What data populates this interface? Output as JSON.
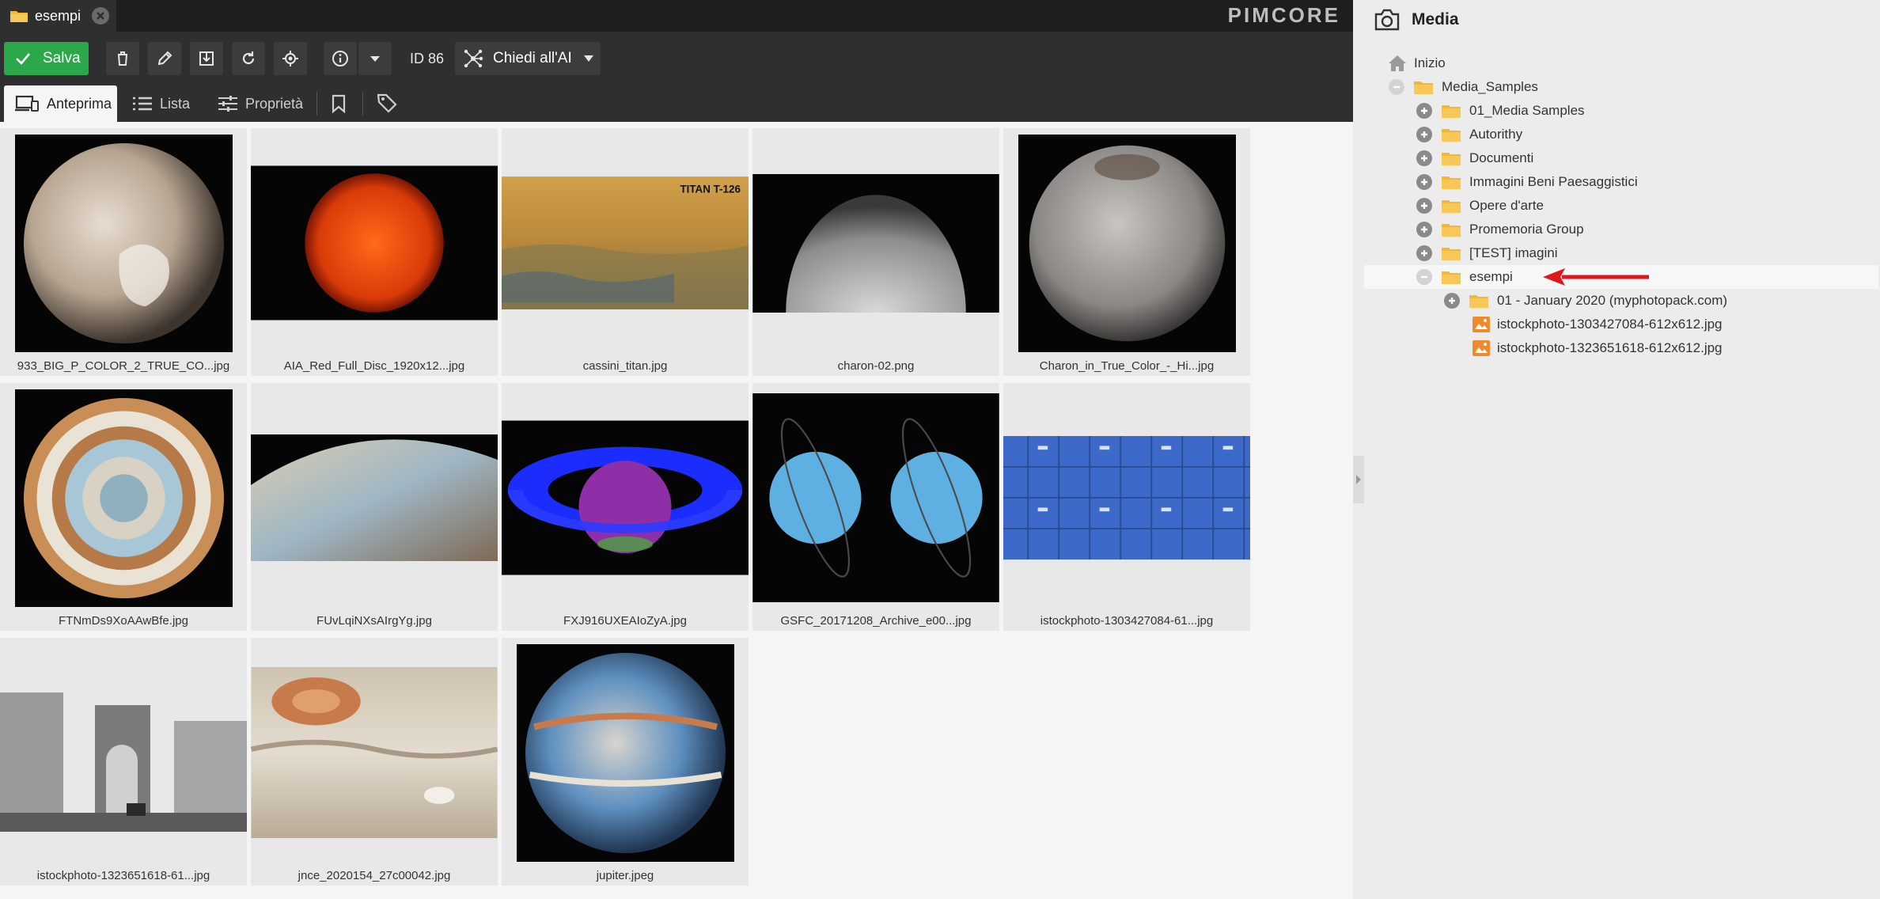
{
  "window": {
    "tab_title": "esempi",
    "brand": "PIMCORE"
  },
  "toolbar": {
    "save_label": "Salva",
    "id_label": "ID 86",
    "ai_label": "Chiedi all'AI"
  },
  "view_tabs": [
    {
      "label": "Anteprima",
      "active": true
    },
    {
      "label": "Lista",
      "active": false
    },
    {
      "label": "Proprietà",
      "active": false
    }
  ],
  "grid": {
    "items": [
      {
        "caption": "933_BIG_P_COLOR_2_TRUE_CO...jpg",
        "icon": "pluto"
      },
      {
        "caption": "AIA_Red_Full_Disc_1920x12...jpg",
        "icon": "sun"
      },
      {
        "caption": "cassini_titan.jpg",
        "icon": "titan",
        "overlay": "TITAN T-126"
      },
      {
        "caption": "charon-02.png",
        "icon": "charon-half"
      },
      {
        "caption": "Charon_in_True_Color_-_Hi...jpg",
        "icon": "charon"
      },
      {
        "caption": "FTNmDs9XoAAwBfe.jpg",
        "icon": "jupiter-pole"
      },
      {
        "caption": "FUvLqiNXsAIrgYg.jpg",
        "icon": "jupiter-clouds"
      },
      {
        "caption": "FXJ916UXEAIoZyA.jpg",
        "icon": "saturn-infrared"
      },
      {
        "caption": "GSFC_20171208_Archive_e00...jpg",
        "icon": "uranus-pair"
      },
      {
        "caption": "istockphoto-1303427084-61...jpg",
        "icon": "filing-cabinets"
      },
      {
        "caption": "istockphoto-1323651618-61...jpg",
        "icon": "paris-street"
      },
      {
        "caption": "jnce_2020154_27c00042.jpg",
        "icon": "great-red-spot"
      },
      {
        "caption": "jupiter.jpeg",
        "icon": "jupiter-globe"
      }
    ]
  },
  "sidebar": {
    "title": "Media",
    "tree": [
      {
        "label": "Inizio",
        "type": "home",
        "level": 0,
        "expander": "none"
      },
      {
        "label": "Media_Samples",
        "type": "folder",
        "level": 0,
        "expander": "minus"
      },
      {
        "label": "01_Media Samples",
        "type": "folder",
        "level": 1,
        "expander": "plus"
      },
      {
        "label": "Autorithy",
        "type": "folder",
        "level": 1,
        "expander": "plus"
      },
      {
        "label": "Documenti",
        "type": "folder",
        "level": 1,
        "expander": "plus"
      },
      {
        "label": "Immagini Beni Paesaggistici",
        "type": "folder",
        "level": 1,
        "expander": "plus"
      },
      {
        "label": "Opere d'arte",
        "type": "folder",
        "level": 1,
        "expander": "plus"
      },
      {
        "label": "Promemoria Group",
        "type": "folder",
        "level": 1,
        "expander": "plus"
      },
      {
        "label": "[TEST] imagini",
        "type": "folder",
        "level": 1,
        "expander": "plus"
      },
      {
        "label": "esempi",
        "type": "folder",
        "level": 1,
        "expander": "minus",
        "selected": true
      },
      {
        "label": "01 - January 2020 (myphotopack.com)",
        "type": "folder",
        "level": 2,
        "expander": "plus"
      },
      {
        "label": "istockphoto-1303427084-612x612.jpg",
        "type": "image",
        "level": 2,
        "expander": "none"
      },
      {
        "label": "istockphoto-1323651618-612x612.jpg",
        "type": "image",
        "level": 2,
        "expander": "none"
      }
    ]
  },
  "colors": {
    "save_green": "#2aa84a",
    "toolbar_dark": "#2f2f2f",
    "folder_yellow": "#f3b733",
    "image_orange": "#f08a2c",
    "annotation_red": "#e0161d"
  }
}
